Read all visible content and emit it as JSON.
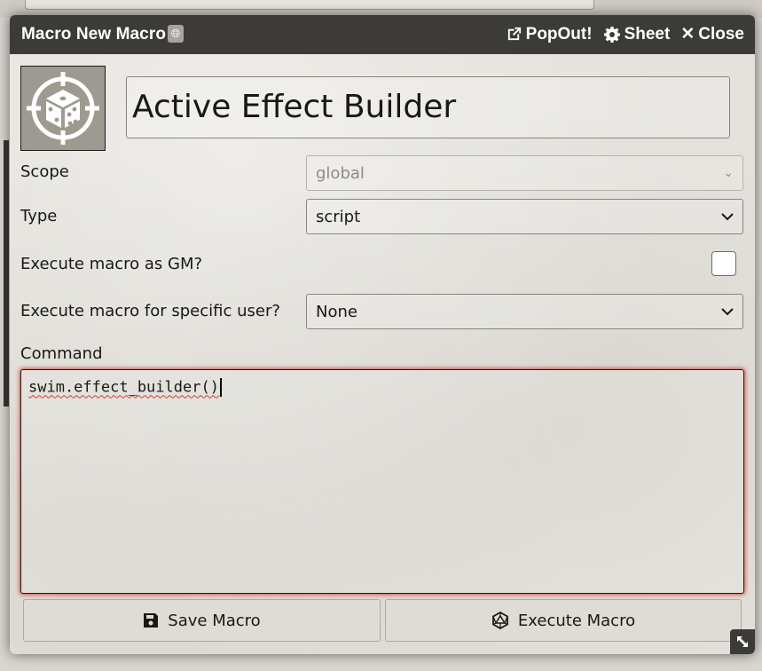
{
  "window": {
    "title": "Macro New Macro",
    "actions": {
      "popout": "PopOut!",
      "sheet": "Sheet",
      "close": "Close"
    }
  },
  "macro": {
    "name": "Active Effect Builder",
    "icon": "dice-target-icon",
    "scope_label": "Scope",
    "scope_value": "global",
    "type_label": "Type",
    "type_value": "script",
    "gm_label": "Execute macro as GM?",
    "gm_checked": false,
    "user_label": "Execute macro for specific user?",
    "user_value": "None",
    "command_label": "Command",
    "command": "swim.effect_builder()"
  },
  "buttons": {
    "save": "Save Macro",
    "execute": "Execute Macro"
  },
  "colors": {
    "titlebar": "#3d3b37",
    "focus_glow": "#d24a3f"
  }
}
